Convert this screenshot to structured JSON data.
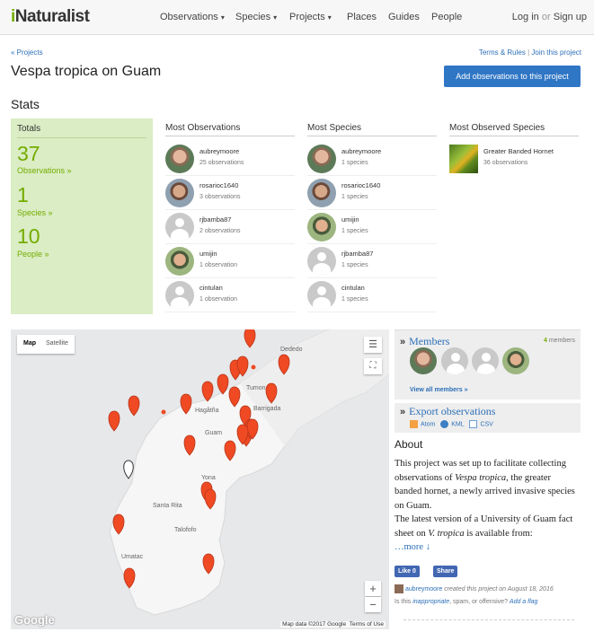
{
  "header": {
    "logo_i": "i",
    "logo_rest": "Naturalist",
    "nav": [
      "Observations",
      "Species",
      "Projects",
      "Places",
      "Guides",
      "People"
    ],
    "login": "Log in",
    "or": "or",
    "signup": "Sign up"
  },
  "breadcrumb": "« Projects",
  "terms": "Terms & Rules",
  "sep": "|",
  "join": "Join this project",
  "title": "Vespa tropica on Guam",
  "add_button": "Add observations to this project",
  "stats": {
    "heading": "Stats",
    "totals_label": "Totals",
    "observations_count": "37",
    "observations_label": "Observations »",
    "species_count": "1",
    "species_label": "Species »",
    "people_count": "10",
    "people_label": "People »"
  },
  "most_observations": {
    "heading": "Most Observations",
    "rows": [
      {
        "name": "aubreymoore",
        "count": "25 observations"
      },
      {
        "name": "rosarioc1640",
        "count": "3 observations"
      },
      {
        "name": "rjbamba87",
        "count": "2 observations"
      },
      {
        "name": "umijin",
        "count": "1 observation"
      },
      {
        "name": "cintulan",
        "count": "1 observation"
      }
    ]
  },
  "most_species": {
    "heading": "Most Species",
    "rows": [
      {
        "name": "aubreymoore",
        "count": "1 species"
      },
      {
        "name": "rosarioc1640",
        "count": "1 species"
      },
      {
        "name": "umijin",
        "count": "1 species"
      },
      {
        "name": "rjbamba87",
        "count": "1 species"
      },
      {
        "name": "cintulan",
        "count": "1 species"
      }
    ]
  },
  "most_observed_species": {
    "heading": "Most Observed Species",
    "name": "Greater Banded Hornet",
    "count": "36 observations"
  },
  "map": {
    "btn_map": "Map",
    "btn_satellite": "Satellite",
    "zoom_in": "+",
    "zoom_out": "−",
    "google": "Google",
    "attribution": "Map data ©2017 Google",
    "terms": "Terms of Use",
    "places": [
      "Dededo",
      "Tumon",
      "Barrigada",
      "Hagåtña",
      "Guam",
      "Yona",
      "Santa Rita",
      "Talofofo",
      "Umatac"
    ]
  },
  "members": {
    "arrow": "»",
    "heading": "Members",
    "count": "4",
    "count_label": "members",
    "view_all": "View all members »"
  },
  "export": {
    "arrow": "»",
    "heading": "Export observations",
    "atom": "Atom",
    "kml": "KML",
    "csv": "CSV"
  },
  "about": {
    "heading": "About",
    "p1_a": "This project was set up to facilitate collecting observations of ",
    "p1_em": "Vespa tropica",
    "p1_b": ", the greater banded hornet, a newly arrived invasive species on Guam.",
    "p2_a": "The latest version of a University of Guam fact sheet on ",
    "p2_em": "V. tropica",
    "p2_b": " is available from:",
    "more": "…more ↓",
    "like": "Like 0",
    "share": "Share",
    "creator_user": "aubreymoore",
    "creator_text": " created this project on August 18, 2016",
    "flag_prefix": "Is this ",
    "flag_link": "inappropriate",
    "flag_mid": ", spam, or offensive? ",
    "flag_add": "Add a flag"
  },
  "colors": {
    "green": "#74ac00",
    "blue": "#2f76c5",
    "marker": "#ef4a23"
  }
}
